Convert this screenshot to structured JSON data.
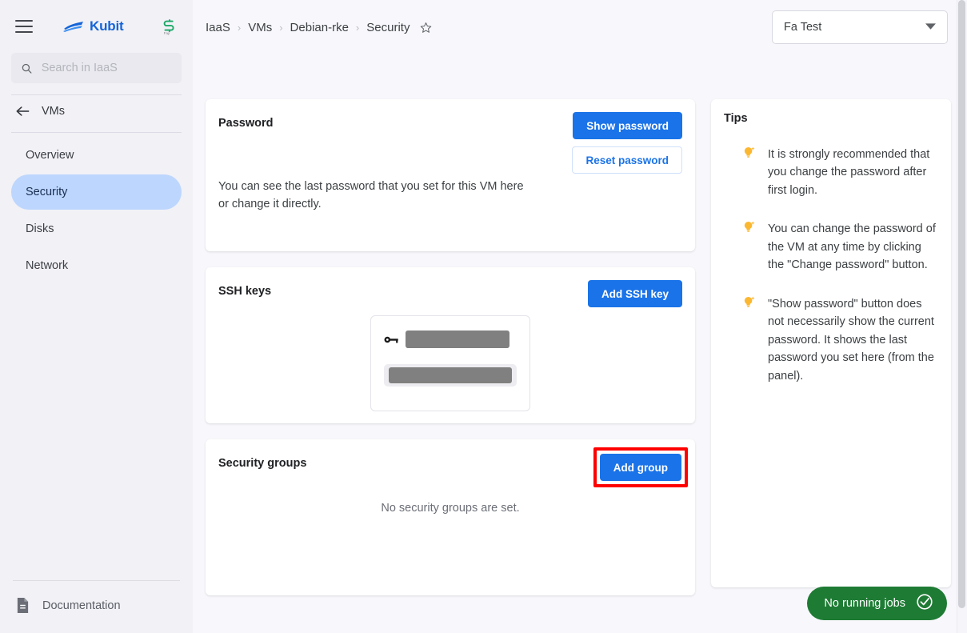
{
  "sidebar": {
    "brand_name": "Kubit",
    "menu_icon": "hamburger-icon",
    "partner_logo": "s-monogram-logo",
    "search": {
      "placeholder": "Search in IaaS",
      "value": "",
      "icon": "search-icon"
    },
    "back": {
      "label": "VMs",
      "icon": "arrow-left-icon"
    },
    "items": [
      {
        "label": "Overview",
        "active": false
      },
      {
        "label": "Security",
        "active": true
      },
      {
        "label": "Disks",
        "active": false
      },
      {
        "label": "Network",
        "active": false
      }
    ],
    "footer": {
      "label": "Documentation",
      "icon": "document-icon"
    },
    "active_item_bg": "#bdd6fd"
  },
  "topbar": {
    "breadcrumb": [
      "IaaS",
      "VMs",
      "Debian-rke",
      "Security"
    ],
    "breadcrumb_separator": "›",
    "favorite_icon": "star-outline-icon",
    "project_selector": {
      "value": "Fa Test",
      "caret_icon": "chevron-down-icon"
    }
  },
  "cards": {
    "password": {
      "title": "Password",
      "body": "You can see the last password that you set for this VM here or change it directly.",
      "primary_button": "Show password",
      "secondary_button": "Reset password"
    },
    "ssh_keys": {
      "title": "SSH keys",
      "button": "Add SSH key",
      "key_icon": "key-icon",
      "redacted_rows": 2
    },
    "security_groups": {
      "title": "Security groups",
      "button": "Add group",
      "empty_text": "No security groups are set.",
      "highlight_color": "#ff0000"
    }
  },
  "tips": {
    "title": "Tips",
    "bulb_icon": "lightbulb-icon",
    "items": [
      "It is strongly recommended that you change the password after first login.",
      "You can change the password of the VM at any time by clicking the \"Change password\" button.",
      "\"Show password\" button does not necessarily show the current password. It shows the last password you set here (from the panel)."
    ]
  },
  "status": {
    "jobs_label": "No running jobs",
    "jobs_icon": "check-circle-icon",
    "jobs_color": "#1e7b34"
  },
  "theme": {
    "accent": "#1a73e8",
    "page_bg": "#f8f8fc",
    "sidebar_bg": "#f1f1f6"
  }
}
